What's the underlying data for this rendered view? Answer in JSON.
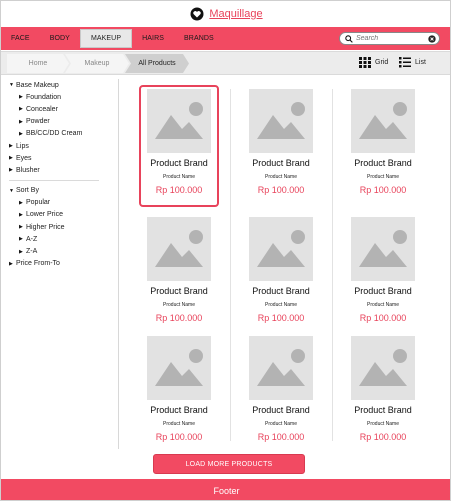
{
  "header": {
    "brand_name": "Maquillage",
    "brand_icon": "heart-icon"
  },
  "nav": {
    "items": [
      {
        "label": "FACE",
        "active": false
      },
      {
        "label": "BODY",
        "active": false
      },
      {
        "label": "MAKEUP",
        "active": true
      },
      {
        "label": "HAIRS",
        "active": false
      },
      {
        "label": "BRANDS",
        "active": false
      }
    ],
    "search": {
      "placeholder": "Search",
      "value": ""
    }
  },
  "breadcrumb": {
    "items": [
      "Home",
      "Makeup",
      "All Products"
    ]
  },
  "view": {
    "grid_label": "Grid",
    "list_label": "List"
  },
  "sidebar": {
    "categories": {
      "title": "Base Makeup",
      "children": [
        "Foundation",
        "Concealer",
        "Powder",
        "BB/CC/DD Cream"
      ],
      "others": [
        "Lips",
        "Eyes",
        "Blusher"
      ]
    },
    "sort": {
      "title": "Sort By",
      "children": [
        "Popular",
        "Lower Price",
        "Higher Price",
        "A-Z",
        "Z-A"
      ],
      "price_filter": "Price From-To"
    }
  },
  "products": [
    {
      "brand": "Product Brand",
      "name": "Product Name",
      "price": "Rp 100.000",
      "selected": true
    },
    {
      "brand": "Product Brand",
      "name": "Product Name",
      "price": "Rp 100.000",
      "selected": false
    },
    {
      "brand": "Product Brand",
      "name": "Product Name",
      "price": "Rp 100.000",
      "selected": false
    },
    {
      "brand": "Product Brand",
      "name": "Product Name",
      "price": "Rp 100.000",
      "selected": false
    },
    {
      "brand": "Product Brand",
      "name": "Product Name",
      "price": "Rp 100.000",
      "selected": false
    },
    {
      "brand": "Product Brand",
      "name": "Product Name",
      "price": "Rp 100.000",
      "selected": false
    },
    {
      "brand": "Product Brand",
      "name": "Product Name",
      "price": "Rp 100.000",
      "selected": false
    },
    {
      "brand": "Product Brand",
      "name": "Product Name",
      "price": "Rp 100.000",
      "selected": false
    },
    {
      "brand": "Product Brand",
      "name": "Product Name",
      "price": "Rp 100.000",
      "selected": false
    }
  ],
  "load_more_label": "LOAD MORE PRODUCTS",
  "footer_label": "Footer",
  "colors": {
    "accent": "#f24a62",
    "price": "#e8435b",
    "placeholder": "#e2e2e2"
  }
}
